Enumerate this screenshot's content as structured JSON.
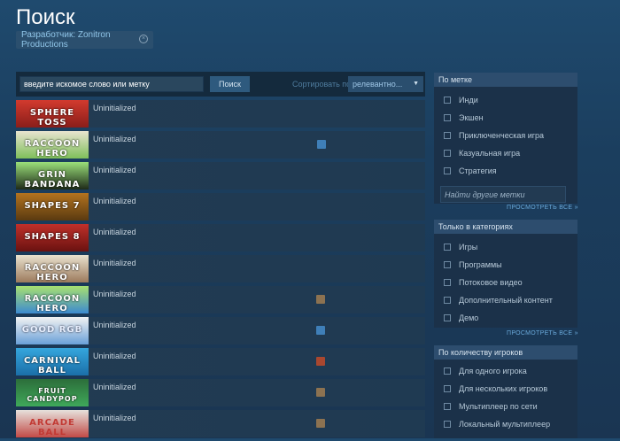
{
  "page": {
    "title": "Поиск"
  },
  "filter_chip": {
    "label": "Разработчик: Zonitron Productions"
  },
  "search": {
    "value": "введите искомое слово или метку",
    "button_label": "Поиск",
    "sort_label": "Сортировать по",
    "sort_value": "релевантно..."
  },
  "results": [
    {
      "capsule": "SPHERE TOSS",
      "name": "Uninitialized",
      "badge": null
    },
    {
      "capsule": "RACCOON HERO",
      "name": "Uninitialized",
      "badge": "blue"
    },
    {
      "capsule": "GRIN BANDANA",
      "name": "Uninitialized",
      "badge": null
    },
    {
      "capsule": "SHAPES 7",
      "name": "Uninitialized",
      "badge": null
    },
    {
      "capsule": "SHAPES 8",
      "name": "Uninitialized",
      "badge": null
    },
    {
      "capsule": "RACCOON HERO",
      "name": "Uninitialized",
      "badge": null
    },
    {
      "capsule": "RACCOON HERO",
      "name": "Uninitialized",
      "badge": "tan"
    },
    {
      "capsule": "GOOD RGB",
      "name": "Uninitialized",
      "badge": "blue"
    },
    {
      "capsule": "CARNIVAL BALL",
      "name": "Uninitialized",
      "badge": "red"
    },
    {
      "capsule": "FRUIT CANDYPOP",
      "name": "Uninitialized",
      "badge": "tan"
    },
    {
      "capsule": "ARCADE BALL",
      "name": "Uninitialized",
      "badge": "tan"
    }
  ],
  "panels": {
    "tags": {
      "header": "По метке",
      "items": [
        "Инди",
        "Экшен",
        "Приключенческая игра",
        "Казуальная игра",
        "Стратегия"
      ],
      "search_placeholder": "Найти другие метки",
      "show_all": "ПРОСМОТРЕТЬ ВСЕ"
    },
    "categories": {
      "header": "Только в категориях",
      "items": [
        "Игры",
        "Программы",
        "Потоковое видео",
        "Дополнительный контент",
        "Демо"
      ],
      "show_all": "ПРОСМОТРЕТЬ ВСЕ"
    },
    "players": {
      "header": "По количеству игроков",
      "items": [
        "Для одного игрока",
        "Для нескольких игроков",
        "Мультиплеер по сети",
        "Локальный мультиплеер"
      ]
    }
  },
  "colors": {
    "badge_blue": "#3f7fb8",
    "badge_tan": "#8c7251",
    "badge_red": "#a9472f"
  }
}
